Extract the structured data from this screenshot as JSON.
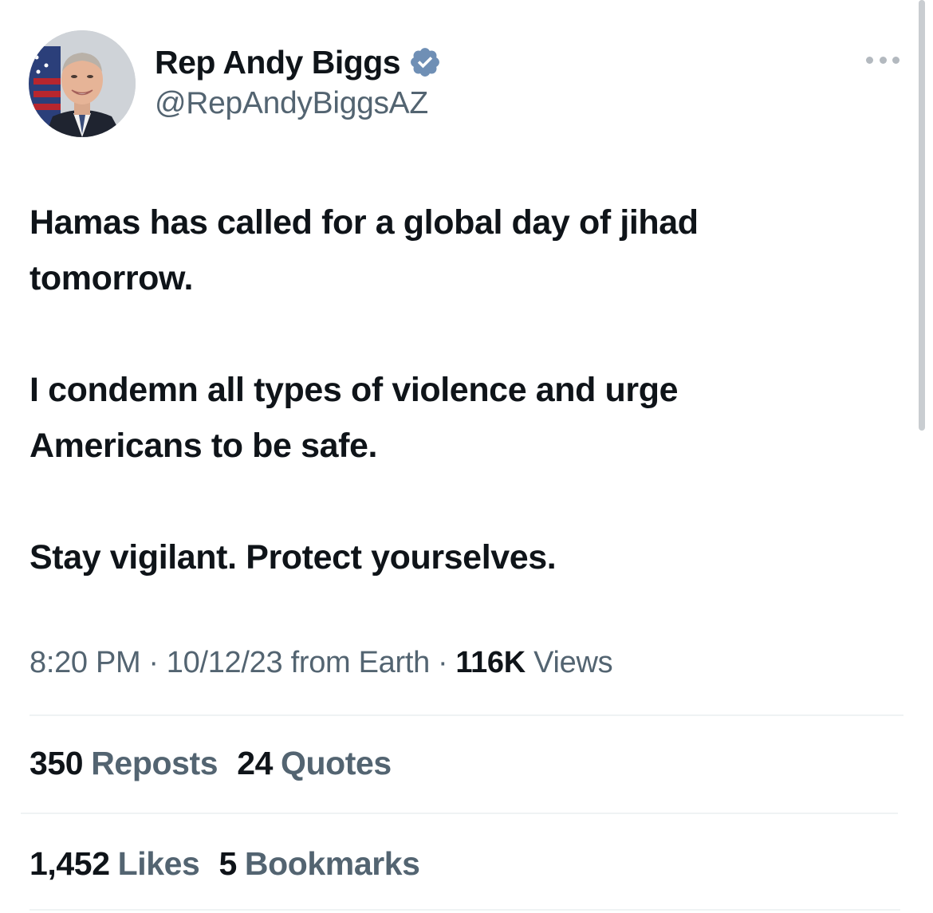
{
  "author": {
    "display_name": "Rep Andy Biggs",
    "handle": "@RepAndyBiggsAZ",
    "verified_icon": "verified-badge-icon",
    "accent_color": "#6f8fb5"
  },
  "tweet": {
    "paragraphs": [
      "Hamas has called for a global day of jihad\ntomorrow.",
      "I condemn all types of violence and urge\nAmericans to be safe.",
      "Stay vigilant. Protect yourselves."
    ]
  },
  "meta": {
    "time": "8:20 PM",
    "date": "10/12/23",
    "source": "from Earth",
    "separator": "·",
    "views_count": "116K",
    "views_label": "Views"
  },
  "engagement": {
    "reposts_count": "350",
    "reposts_label": "Reposts",
    "quotes_count": "24",
    "quotes_label": "Quotes",
    "likes_count": "1,452",
    "likes_label": "Likes",
    "bookmarks_count": "5",
    "bookmarks_label": "Bookmarks"
  },
  "colors": {
    "text_primary": "#0f1419",
    "text_secondary": "#536471",
    "divider": "#eff3f4"
  }
}
